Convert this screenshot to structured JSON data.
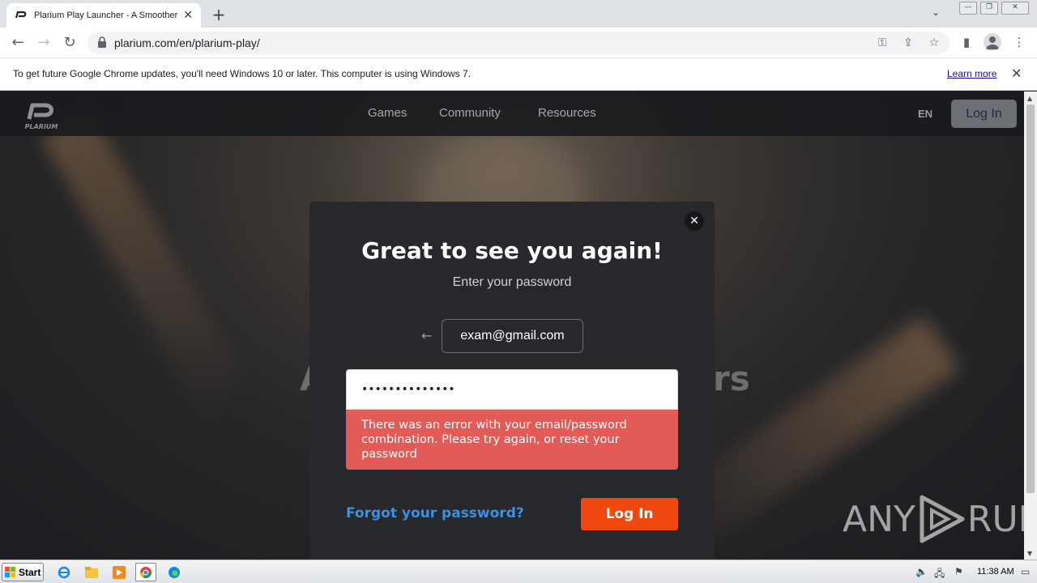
{
  "browser": {
    "tab_title": "Plarium Play Launcher - A Smoother",
    "url": "plarium.com/en/plarium-play/",
    "infobar_message": "To get future Google Chrome updates, you'll need Windows 10 or later. This computer is using Windows 7.",
    "infobar_link": "Learn more"
  },
  "header": {
    "logo_text": "PLARIUM",
    "nav": [
      "Games",
      "Community",
      "Resources"
    ],
    "language": "EN",
    "login_label": "Log In"
  },
  "hero": {
    "left_fragment": "A",
    "right_fragment": "rs"
  },
  "modal": {
    "title": "Great to see you again!",
    "subtitle": "Enter your password",
    "email": "exam@gmail.com",
    "password_value": "••••••••••••••",
    "error": "There was an error with your email/password combination. Please try again, or reset your password",
    "forgot_label": "Forgot your password?",
    "login_label": "Log In"
  },
  "watermark": {
    "left": "ANY",
    "right": "RUN"
  },
  "taskbar": {
    "start_label": "Start",
    "clock": "11:38 AM"
  },
  "colors": {
    "accent_orange": "#f0480f",
    "error_red": "#e35b57",
    "link_blue": "#3d8fe0"
  }
}
